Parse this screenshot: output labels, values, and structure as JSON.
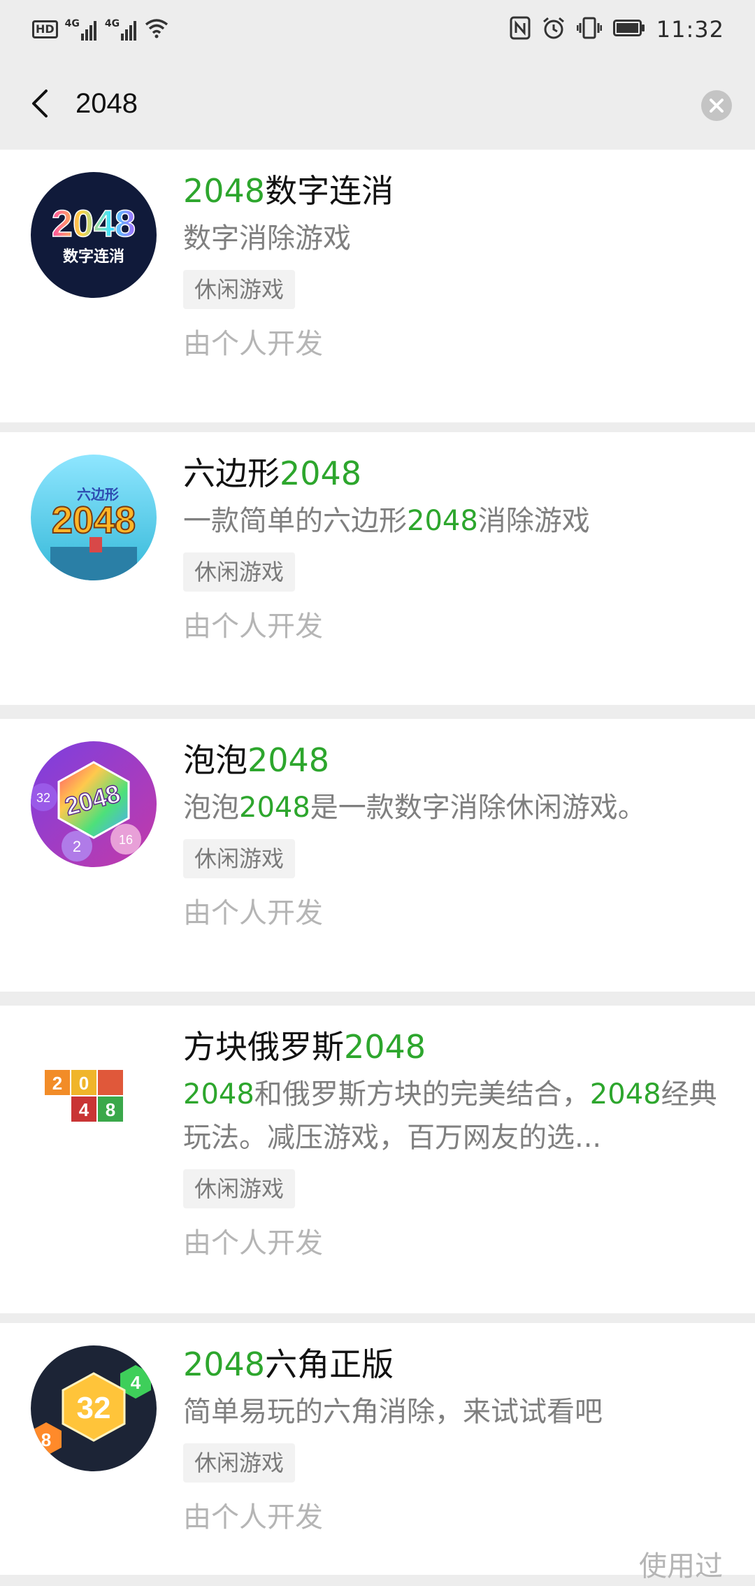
{
  "status_bar": {
    "hd": "HD",
    "net1": "4G",
    "net2": "4G",
    "time": "11:32",
    "icons": [
      "hd-icon",
      "signal-icon",
      "wifi-icon",
      "nfc-icon",
      "alarm-icon",
      "vibrate-icon",
      "battery-icon"
    ]
  },
  "search": {
    "query": "2048",
    "icons": [
      "back-arrow-icon",
      "clear-icon"
    ]
  },
  "results": [
    {
      "title_pre": "",
      "title_hl": "2048",
      "title_post": "数字连消",
      "desc_parts": [
        {
          "text": "数字消除游戏",
          "hl": false
        }
      ],
      "tag": "休闲游戏",
      "developer": "由个人开发",
      "used": ""
    },
    {
      "title_pre": "六边形",
      "title_hl": "2048",
      "title_post": "",
      "desc_parts": [
        {
          "text": "一款简单的六边形",
          "hl": false
        },
        {
          "text": "2048",
          "hl": true
        },
        {
          "text": "消除游戏",
          "hl": false
        }
      ],
      "tag": "休闲游戏",
      "developer": "由个人开发",
      "used": ""
    },
    {
      "title_pre": "泡泡",
      "title_hl": "2048",
      "title_post": "",
      "desc_parts": [
        {
          "text": "泡泡",
          "hl": false
        },
        {
          "text": "2048",
          "hl": true
        },
        {
          "text": "是一款数字消除休闲游戏。",
          "hl": false
        }
      ],
      "tag": "休闲游戏",
      "developer": "由个人开发",
      "used": ""
    },
    {
      "title_pre": "方块俄罗斯",
      "title_hl": "2048",
      "title_post": "",
      "desc_parts": [
        {
          "text": "2048",
          "hl": true
        },
        {
          "text": "和俄罗斯方块的完美结合，",
          "hl": false
        },
        {
          "text": "2048",
          "hl": true
        },
        {
          "text": "经典玩法。减压游戏，百万网友的选...",
          "hl": false
        }
      ],
      "tag": "休闲游戏",
      "developer": "由个人开发",
      "used": ""
    },
    {
      "title_pre": "",
      "title_hl": "2048",
      "title_post": "六角正版",
      "desc_parts": [
        {
          "text": "简单易玩的六角消除，来试试看吧",
          "hl": false
        }
      ],
      "tag": "休闲游戏",
      "developer": "由个人开发",
      "used": "使用过"
    }
  ],
  "icon_art": {
    "app1": {
      "top": "2048",
      "bottom": "数字连消"
    },
    "app2": {
      "top": "六边形",
      "main": "2048"
    },
    "app3": {
      "main": "2048",
      "b1": "32",
      "b2": "2",
      "b3": "16"
    },
    "app4": {
      "cells": [
        "2",
        "0",
        "4",
        "8"
      ]
    },
    "app5": {
      "main": "32",
      "a": "4",
      "b": "8"
    }
  },
  "colors": {
    "highlight": "#2da62d",
    "background": "#ededed",
    "card": "#ffffff"
  }
}
